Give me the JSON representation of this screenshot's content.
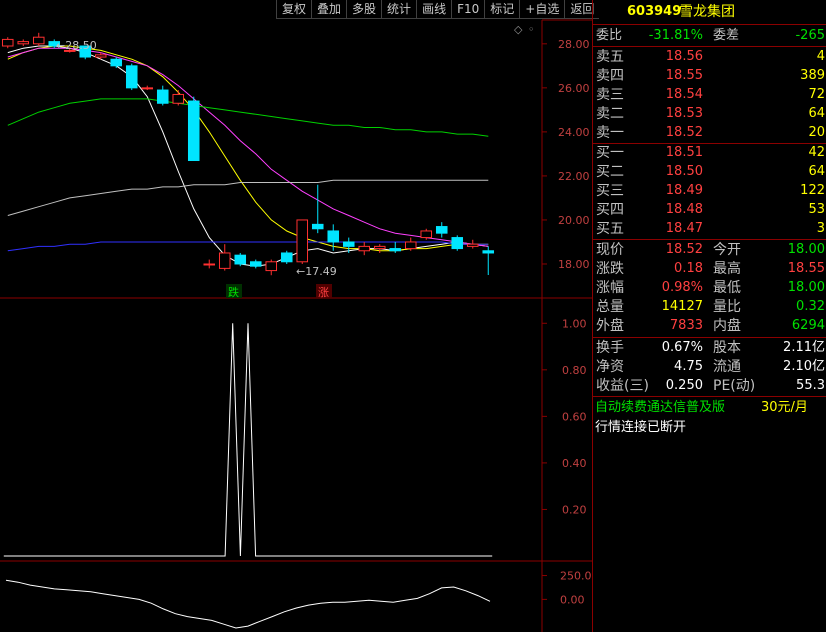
{
  "toolbar": {
    "items": [
      "复权",
      "叠加",
      "多股",
      "统计",
      "画线",
      "F10",
      "标记",
      "+自选",
      "返回"
    ]
  },
  "stock": {
    "code": "603949",
    "name": "雪龙集团"
  },
  "ratio": {
    "label1": "委比",
    "value1": "-31.81%",
    "label2": "委差",
    "value2": "-265"
  },
  "asks": [
    {
      "label": "卖五",
      "price": "18.56",
      "vol": "4"
    },
    {
      "label": "卖四",
      "price": "18.55",
      "vol": "389"
    },
    {
      "label": "卖三",
      "price": "18.54",
      "vol": "72"
    },
    {
      "label": "卖二",
      "price": "18.53",
      "vol": "64"
    },
    {
      "label": "卖一",
      "price": "18.52",
      "vol": "20"
    }
  ],
  "bids": [
    {
      "label": "买一",
      "price": "18.51",
      "vol": "42"
    },
    {
      "label": "买二",
      "price": "18.50",
      "vol": "64"
    },
    {
      "label": "买三",
      "price": "18.49",
      "vol": "122"
    },
    {
      "label": "买四",
      "price": "18.48",
      "vol": "53"
    },
    {
      "label": "买五",
      "price": "18.47",
      "vol": "3"
    }
  ],
  "quote": [
    {
      "l1": "现价",
      "v1": "18.52",
      "c1": "red",
      "l2": "今开",
      "v2": "18.00",
      "c2": "green"
    },
    {
      "l1": "涨跌",
      "v1": "0.18",
      "c1": "red",
      "l2": "最高",
      "v2": "18.55",
      "c2": "red"
    },
    {
      "l1": "涨幅",
      "v1": "0.98%",
      "c1": "red",
      "l2": "最低",
      "v2": "18.00",
      "c2": "green"
    },
    {
      "l1": "总量",
      "v1": "14127",
      "c1": "yellow",
      "l2": "量比",
      "v2": "0.32",
      "c2": "green"
    },
    {
      "l1": "外盘",
      "v1": "7833",
      "c1": "red",
      "l2": "内盘",
      "v2": "6294",
      "c2": "green"
    }
  ],
  "fund": [
    {
      "l1": "换手",
      "v1": "0.67%",
      "l2": "股本",
      "v2": "2.11亿"
    },
    {
      "l1": "净资",
      "v1": "4.75",
      "l2": "流通",
      "v2": "2.10亿"
    },
    {
      "l1": "收益(三)",
      "v1": "0.250",
      "l2": "PE(动)",
      "v2": "55.3"
    }
  ],
  "promo": {
    "text": "自动续费通达信普及版",
    "price": "30元/月"
  },
  "status": "行情连接已断开",
  "main_axis": [
    "28.00",
    "26.00",
    "24.00",
    "22.00",
    "20.00",
    "18.00"
  ],
  "mid_axis": [
    "1.00",
    "0.80",
    "0.60",
    "0.40",
    "0.20"
  ],
  "bot_axis": [
    "250.0",
    "0.00"
  ],
  "annotations": {
    "high": "28.50",
    "low": "17.49",
    "down": "跌",
    "up": "涨"
  },
  "colors": {
    "up": "#ff3030",
    "down": "#00e5ff",
    "grid": "#8b0000"
  },
  "chart_data": [
    {
      "type": "candlestick",
      "ylim": [
        17.0,
        28.9
      ],
      "ma_lines": [
        {
          "color": "#ffffff",
          "values": [
            27.6,
            27.8,
            27.9,
            27.9,
            27.8,
            27.6,
            27.3,
            27.0,
            26.5,
            25.6,
            24.0,
            22.2,
            20.5,
            19.2,
            18.4,
            18.0,
            17.9,
            18.0,
            18.3,
            18.6,
            18.7,
            18.5,
            18.6,
            18.7,
            18.7,
            18.6,
            18.7,
            18.8,
            18.9,
            19.0,
            18.9,
            18.8
          ]
        },
        {
          "color": "#ffff00",
          "values": [
            27.3,
            27.6,
            27.8,
            27.9,
            27.9,
            27.8,
            27.7,
            27.5,
            27.3,
            27.0,
            26.5,
            25.8,
            25.0,
            24.0,
            22.9,
            21.8,
            20.8,
            20.0,
            19.5,
            19.2,
            19.0,
            18.8,
            18.7,
            18.7,
            18.6,
            18.6,
            18.7,
            18.7,
            18.8,
            18.9,
            18.9,
            18.9
          ]
        },
        {
          "color": "#ff40ff",
          "values": [
            27.4,
            27.6,
            27.8,
            27.8,
            27.8,
            27.7,
            27.6,
            27.4,
            27.2,
            27.0,
            26.6,
            26.1,
            25.5,
            24.9,
            24.3,
            23.6,
            23.0,
            22.3,
            21.8,
            21.3,
            20.9,
            20.5,
            20.2,
            19.9,
            19.6,
            19.4,
            19.3,
            19.2,
            19.1,
            19.0,
            18.9,
            18.8
          ]
        },
        {
          "color": "#00d000",
          "values": [
            24.3,
            24.6,
            24.9,
            25.1,
            25.3,
            25.4,
            25.5,
            25.5,
            25.5,
            25.5,
            25.4,
            25.3,
            25.2,
            25.1,
            25.0,
            24.9,
            24.8,
            24.7,
            24.6,
            24.5,
            24.4,
            24.3,
            24.3,
            24.2,
            24.2,
            24.1,
            24.1,
            24.0,
            24.0,
            23.9,
            23.9,
            23.8
          ]
        },
        {
          "color": "#c0c0c0",
          "values": [
            20.2,
            20.4,
            20.6,
            20.8,
            21.0,
            21.1,
            21.2,
            21.3,
            21.4,
            21.4,
            21.5,
            21.5,
            21.6,
            21.6,
            21.6,
            21.7,
            21.7,
            21.7,
            21.7,
            21.7,
            21.7,
            21.8,
            21.8,
            21.8,
            21.8,
            21.8,
            21.8,
            21.8,
            21.8,
            21.8,
            21.8,
            21.8
          ]
        },
        {
          "color": "#3030ff",
          "values": [
            18.6,
            18.7,
            18.8,
            18.8,
            18.9,
            18.9,
            19.0,
            19.0,
            19.0,
            19.0,
            19.0,
            19.0,
            19.0,
            19.0,
            19.0,
            19.0,
            19.0,
            19.0,
            19.0,
            19.0,
            19.0,
            19.0,
            19.0,
            19.0,
            19.0,
            19.0,
            19.0,
            19.0,
            19.0,
            18.9,
            18.9,
            18.9
          ]
        }
      ],
      "candles": [
        {
          "o": 27.9,
          "c": 28.2,
          "h": 28.3,
          "l": 27.8
        },
        {
          "o": 28.0,
          "c": 28.1,
          "h": 28.2,
          "l": 27.9
        },
        {
          "o": 28.0,
          "c": 28.3,
          "h": 28.5,
          "l": 27.9
        },
        {
          "o": 28.1,
          "c": 27.9,
          "h": 28.2,
          "l": 27.8
        },
        {
          "o": 27.7,
          "c": 27.7,
          "h": 27.8,
          "l": 27.6
        },
        {
          "o": 27.9,
          "c": 27.4,
          "h": 27.9,
          "l": 27.3
        },
        {
          "o": 27.4,
          "c": 27.5,
          "h": 27.6,
          "l": 27.3
        },
        {
          "o": 27.3,
          "c": 27.0,
          "h": 27.4,
          "l": 26.9
        },
        {
          "o": 27.0,
          "c": 26.0,
          "h": 27.1,
          "l": 25.9
        },
        {
          "o": 26.0,
          "c": 26.0,
          "h": 26.1,
          "l": 25.9
        },
        {
          "o": 25.9,
          "c": 25.3,
          "h": 26.1,
          "l": 25.2
        },
        {
          "o": 25.3,
          "c": 25.7,
          "h": 25.9,
          "l": 25.2
        },
        {
          "o": 25.4,
          "c": 22.7,
          "h": 25.6,
          "l": 22.7
        },
        {
          "o": 18.0,
          "c": 18.0,
          "h": 18.2,
          "l": 17.8
        },
        {
          "o": 17.8,
          "c": 18.5,
          "h": 18.9,
          "l": 17.7
        },
        {
          "o": 18.4,
          "c": 18.0,
          "h": 18.5,
          "l": 17.9
        },
        {
          "o": 18.1,
          "c": 17.9,
          "h": 18.2,
          "l": 17.8
        },
        {
          "o": 17.7,
          "c": 18.1,
          "h": 18.2,
          "l": 17.49
        },
        {
          "o": 18.5,
          "c": 18.1,
          "h": 18.6,
          "l": 18.0
        },
        {
          "o": 18.1,
          "c": 20.0,
          "h": 20.0,
          "l": 18.0
        },
        {
          "o": 19.8,
          "c": 19.6,
          "h": 21.6,
          "l": 19.4
        },
        {
          "o": 19.5,
          "c": 19.0,
          "h": 19.8,
          "l": 18.6
        },
        {
          "o": 19.0,
          "c": 18.8,
          "h": 19.2,
          "l": 18.5
        },
        {
          "o": 18.6,
          "c": 18.8,
          "h": 19.0,
          "l": 18.4
        },
        {
          "o": 18.7,
          "c": 18.8,
          "h": 18.9,
          "l": 18.5
        },
        {
          "o": 18.7,
          "c": 18.6,
          "h": 19.0,
          "l": 18.5
        },
        {
          "o": 18.7,
          "c": 19.0,
          "h": 19.2,
          "l": 18.6
        },
        {
          "o": 19.2,
          "c": 19.5,
          "h": 19.6,
          "l": 19.1
        },
        {
          "o": 19.7,
          "c": 19.4,
          "h": 19.9,
          "l": 19.2
        },
        {
          "o": 19.2,
          "c": 18.7,
          "h": 19.3,
          "l": 18.6
        },
        {
          "o": 18.8,
          "c": 18.9,
          "h": 19.1,
          "l": 18.7
        },
        {
          "o": 18.6,
          "c": 18.5,
          "h": 18.8,
          "l": 17.5
        }
      ]
    },
    {
      "type": "line",
      "ylim": [
        0.0,
        1.1
      ],
      "values": [
        0,
        0,
        0,
        0,
        0,
        0,
        0,
        0,
        0,
        0,
        0,
        0,
        0,
        0,
        0,
        0,
        0,
        0,
        0,
        0,
        0,
        0,
        0,
        0,
        0,
        0,
        0,
        0,
        0,
        0,
        1,
        0,
        1,
        0,
        0,
        0,
        0,
        0,
        0,
        0,
        0,
        0,
        0,
        0,
        0,
        0,
        0,
        0,
        0,
        0,
        0,
        0,
        0,
        0,
        0,
        0,
        0,
        0,
        0,
        0,
        0,
        0,
        0,
        0,
        0
      ]
    },
    {
      "type": "line",
      "ylim": [
        -300,
        350
      ],
      "values": [
        200,
        180,
        150,
        130,
        110,
        100,
        90,
        80,
        60,
        40,
        20,
        0,
        -40,
        -100,
        -150,
        -180,
        -200,
        -220,
        -260,
        -300,
        -280,
        -230,
        -180,
        -130,
        -90,
        -60,
        -40,
        -30,
        -30,
        -20,
        -10,
        -20,
        -30,
        -10,
        10,
        60,
        120,
        130,
        90,
        40,
        -20
      ]
    }
  ]
}
